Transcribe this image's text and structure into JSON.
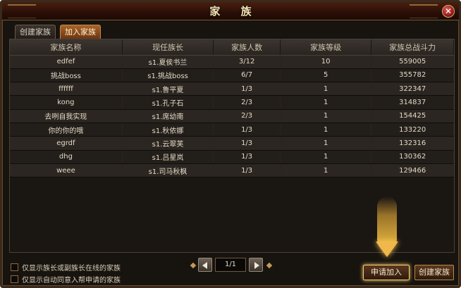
{
  "window": {
    "title": "家 族",
    "close_label": "✕"
  },
  "tabs": [
    {
      "label": "创建家族",
      "active": false
    },
    {
      "label": "加入家族",
      "active": true
    }
  ],
  "table": {
    "headers": [
      "家族名称",
      "现任族长",
      "家族人数",
      "家族等级",
      "家族总战斗力"
    ],
    "rows": [
      [
        "edfef",
        "s1.夏侯书兰",
        "3/12",
        "10",
        "559005"
      ],
      [
        "挑战boss",
        "s1.挑战boss",
        "6/7",
        "5",
        "355782"
      ],
      [
        "ffffff",
        "s1.鲁平夏",
        "1/3",
        "1",
        "322347"
      ],
      [
        "kong",
        "s1.孔子石",
        "2/3",
        "1",
        "314837"
      ],
      [
        "去咧自我实现",
        "s1.席幼南",
        "2/3",
        "1",
        "154425"
      ],
      [
        "你的你的哦",
        "s1.秋依娜",
        "1/3",
        "1",
        "133220"
      ],
      [
        "egrdf",
        "s1.云翠芙",
        "1/3",
        "1",
        "132316"
      ],
      [
        "dhg",
        "s1.吕星岚",
        "1/3",
        "1",
        "130362"
      ],
      [
        "weee",
        "s1.司马秋枫",
        "1/3",
        "1",
        "129466"
      ]
    ]
  },
  "filters": [
    {
      "label": "仅显示族长或副族长在线的家族",
      "checked": false
    },
    {
      "label": "仅显示自动同意入帮申请的家族",
      "checked": false
    }
  ],
  "pager": {
    "page_text": "1/1"
  },
  "buttons": {
    "apply": "申请加入",
    "create": "创建家族"
  },
  "colors": {
    "accent": "#f0b84a",
    "active_tab": "#a8642a",
    "background": "#17130f"
  }
}
